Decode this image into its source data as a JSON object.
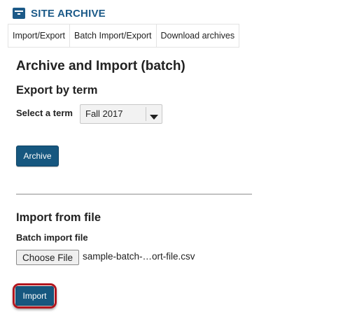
{
  "header": {
    "title": "SITE ARCHIVE",
    "icon": "archive-icon",
    "accent_color": "#1c5a88"
  },
  "tabs": [
    {
      "label": "Import/Export"
    },
    {
      "label": "Batch Import/Export"
    },
    {
      "label": "Download archives"
    }
  ],
  "main": {
    "title": "Archive and Import (batch)",
    "export_section": {
      "heading": "Export by term",
      "term_label": "Select a term",
      "term_selected": "Fall 2017",
      "archive_button": "Archive"
    },
    "import_section": {
      "heading": "Import from file",
      "file_label": "Batch import file",
      "choose_file_button": "Choose File",
      "file_name": "sample-batch-…ort-file.csv",
      "import_button": "Import",
      "highlight_color": "#b3161e"
    }
  },
  "colors": {
    "button_primary": "#16577f"
  }
}
